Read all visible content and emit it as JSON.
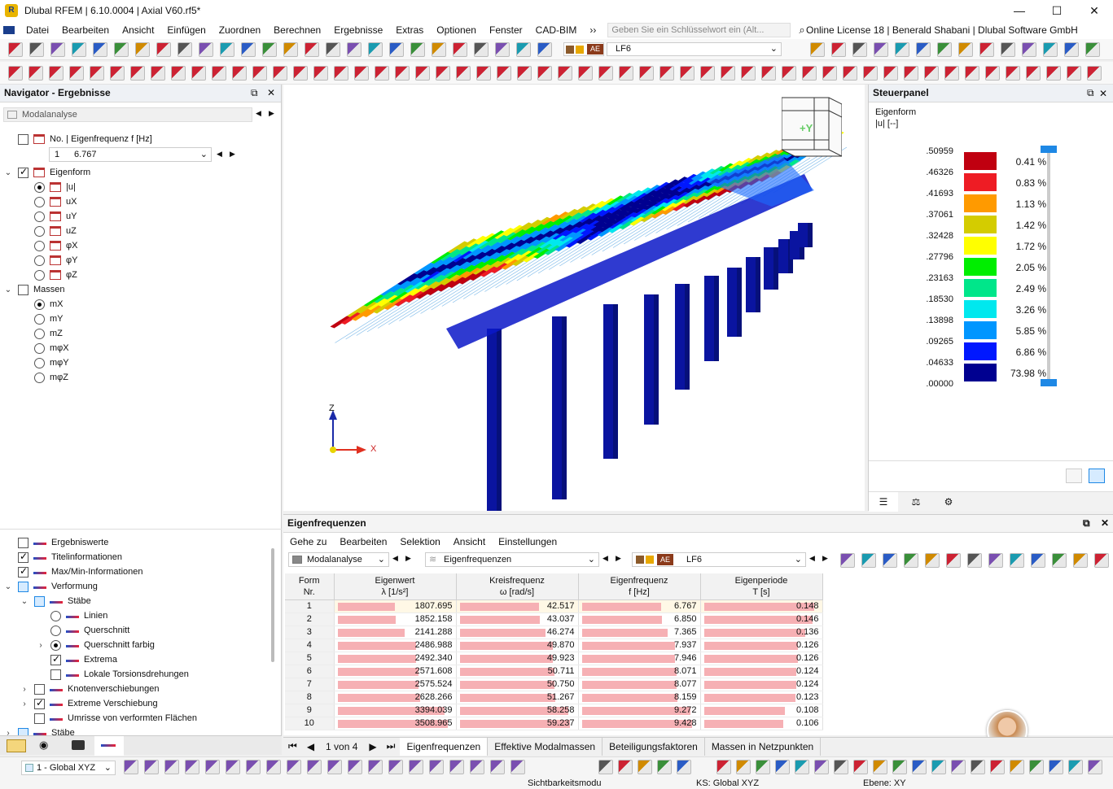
{
  "window": {
    "title": "Dlubal RFEM | 6.10.0004 | Axial V60.rf5*",
    "min": "—",
    "max": "☐",
    "close": "✕"
  },
  "menu": [
    "Datei",
    "Bearbeiten",
    "Ansicht",
    "Einfügen",
    "Zuordnen",
    "Berechnen",
    "Ergebnisse",
    "Extras",
    "Optionen",
    "Fenster",
    "CAD-BIM"
  ],
  "search_placeholder": "Geben Sie ein Schlüsselwort ein (Alt...",
  "license": "Online License 18 | Benerald Shabani | Dlubal Software GmbH",
  "toolbar1": {
    "lc_code": "AE",
    "lc_name": "LF6"
  },
  "navigator": {
    "title": "Navigator - Ergebnisse",
    "dropdown": "Modalanalyse",
    "mode_label": "No. | Eigenfrequenz f [Hz]",
    "mode_no": "1",
    "mode_freq": "6.767",
    "eigenform": "Eigenform",
    "components": [
      "|u|",
      "uX",
      "uY",
      "uZ",
      "φX",
      "φY",
      "φZ"
    ],
    "massen": "Massen",
    "masses": [
      "mX",
      "mY",
      "mZ",
      "mφX",
      "mφY",
      "mφZ"
    ],
    "lower": [
      "Ergebniswerte",
      "Titelinformationen",
      "Max/Min-Informationen",
      "Verformung",
      "Stäbe",
      "Linien",
      "Querschnitt",
      "Querschnitt farbig",
      "Extrema",
      "Lokale Torsionsdrehungen",
      "Knotenverschiebungen",
      "Extreme Verschiebung",
      "Umrisse von verformten Flächen",
      "Stäbe"
    ]
  },
  "viewport": {
    "cube_label": "+Y",
    "axis_z": "Z",
    "axis_x": "X"
  },
  "steuerpanel": {
    "title": "Steuerpanel",
    "subtitle": "Eigenform",
    "unit": "|u| [--]",
    "values": [
      ".50959",
      ".46326",
      ".41693",
      ".37061",
      ".32428",
      ".27796",
      ".23163",
      ".18530",
      ".13898",
      ".09265",
      ".04633",
      ".00000"
    ],
    "colors": [
      "#c00010",
      "#ee1c24",
      "#ff9a00",
      "#d4cc00",
      "#ffff00",
      "#00ee00",
      "#00e68a",
      "#00e8ee",
      "#0096ff",
      "#0018ff",
      "#000090"
    ],
    "percents": [
      "0.41 %",
      "0.83 %",
      "1.13 %",
      "1.42 %",
      "1.72 %",
      "2.05 %",
      "2.49 %",
      "3.26 %",
      "5.85 %",
      "6.86 %",
      "73.98 %"
    ]
  },
  "results": {
    "title": "Eigenfrequenzen",
    "menu": [
      "Gehe zu",
      "Bearbeiten",
      "Selektion",
      "Ansicht",
      "Einstellungen"
    ],
    "analysis": "Modalanalyse",
    "table_name": "Eigenfrequenzen",
    "lc_code": "AE",
    "lc_name": "LF6",
    "columns": [
      {
        "h1": "Form",
        "h2": "Nr."
      },
      {
        "h1": "Eigenwert",
        "h2": "λ [1/s²]"
      },
      {
        "h1": "Kreisfrequenz",
        "h2": "ω [rad/s]"
      },
      {
        "h1": "Eigenfrequenz",
        "h2": "f [Hz]"
      },
      {
        "h1": "Eigenperiode",
        "h2": "T [s]"
      }
    ],
    "rows": [
      [
        "1",
        "1807.695",
        "42.517",
        "6.767",
        "0.148"
      ],
      [
        "2",
        "1852.158",
        "43.037",
        "6.850",
        "0.146"
      ],
      [
        "3",
        "2141.288",
        "46.274",
        "7.365",
        "0.136"
      ],
      [
        "4",
        "2486.988",
        "49.870",
        "7.937",
        "0.126"
      ],
      [
        "5",
        "2492.340",
        "49.923",
        "7.946",
        "0.126"
      ],
      [
        "6",
        "2571.608",
        "50.711",
        "8.071",
        "0.124"
      ],
      [
        "7",
        "2575.524",
        "50.750",
        "8.077",
        "0.124"
      ],
      [
        "8",
        "2628.266",
        "51.267",
        "8.159",
        "0.123"
      ],
      [
        "9",
        "3394.039",
        "58.258",
        "9.272",
        "0.108"
      ],
      [
        "10",
        "3508.965",
        "59.237",
        "9.428",
        "0.106"
      ]
    ],
    "pager": "1 von 4",
    "tabs": [
      "Eigenfrequenzen",
      "Effektive Modalmassen",
      "Beteiligungsfaktoren",
      "Massen in Netzpunkten"
    ]
  },
  "status": {
    "cs": "1 - Global XYZ",
    "sicht": "Sichtbarkeitsmodu",
    "ks": "KS: Global XYZ",
    "ebene": "Ebene: XY"
  }
}
